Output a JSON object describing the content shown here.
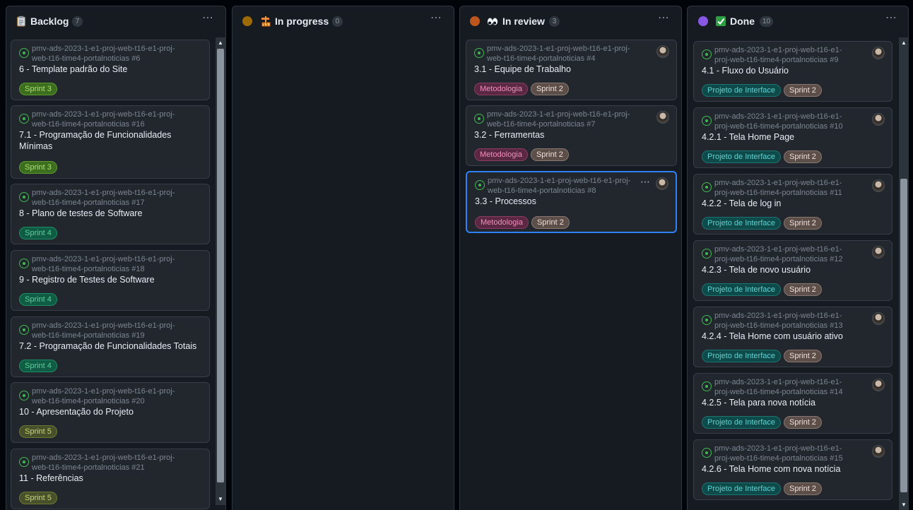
{
  "columns": [
    {
      "title": "Backlog",
      "count": "7",
      "emoji_icon": "clipboard-icon",
      "status_color": null,
      "cards": [
        {
          "repo_line1": "pmv-ads-2023-1-e1-proj-web-t16-e1-proj-",
          "repo_line2": "web-t16-time4-portalnoticias #6",
          "title": "6 - Template padrão do Site",
          "labels": [
            "Sprint 3"
          ]
        },
        {
          "repo_line1": "pmv-ads-2023-1-e1-proj-web-t16-e1-proj-",
          "repo_line2": "web-t16-time4-portalnoticias #16",
          "title": "7.1 - Programação de Funcionalidades Mínimas",
          "labels": [
            "Sprint 3"
          ]
        },
        {
          "repo_line1": "pmv-ads-2023-1-e1-proj-web-t16-e1-proj-",
          "repo_line2": "web-t16-time4-portalnoticias #17",
          "title": "8 - Plano de testes de Software",
          "labels": [
            "Sprint 4"
          ]
        },
        {
          "repo_line1": "pmv-ads-2023-1-e1-proj-web-t16-e1-proj-",
          "repo_line2": "web-t16-time4-portalnoticias #18",
          "title": "9 - Registro de Testes de Software",
          "labels": [
            "Sprint 4"
          ]
        },
        {
          "repo_line1": "pmv-ads-2023-1-e1-proj-web-t16-e1-proj-",
          "repo_line2": "web-t16-time4-portalnoticias #19",
          "title": "7.2 - Programação de Funcionalidades Totais",
          "labels": [
            "Sprint 4"
          ]
        },
        {
          "repo_line1": "pmv-ads-2023-1-e1-proj-web-t16-e1-proj-",
          "repo_line2": "web-t16-time4-portalnoticias #20",
          "title": "10 - Apresentação do Projeto",
          "labels": [
            "Sprint 5"
          ]
        },
        {
          "repo_line1": "pmv-ads-2023-1-e1-proj-web-t16-e1-proj-",
          "repo_line2": "web-t16-time4-portalnoticias #21",
          "title": "11 - Referências",
          "labels": [
            "Sprint 5"
          ]
        }
      ]
    },
    {
      "title": "In progress",
      "count": "0",
      "emoji_icon": "construction-icon",
      "status_color": "#9e6a03",
      "cards": []
    },
    {
      "title": "In review",
      "count": "3",
      "emoji_icon": "eyes-icon",
      "status_color": "#bd561d",
      "cards": [
        {
          "repo_line1": "pmv-ads-2023-1-e1-proj-web-t16-e1-proj-",
          "repo_line2": "web-t16-time4-portalnoticias #4",
          "title": "3.1 - Equipe de Trabalho",
          "labels": [
            "Metodologia",
            "Sprint 2"
          ]
        },
        {
          "repo_line1": "pmv-ads-2023-1-e1-proj-web-t16-e1-proj-",
          "repo_line2": "web-t16-time4-portalnoticias #7",
          "title": "3.2 - Ferramentas",
          "labels": [
            "Metodologia",
            "Sprint 2"
          ]
        },
        {
          "repo_line1": "pmv-ads-2023-1-e1-proj-web-t16-e1-proj-",
          "repo_line2": "web-t16-time4-portalnoticias #8",
          "title": "3.3 - Processos",
          "labels": [
            "Metodologia",
            "Sprint 2"
          ],
          "selected": true
        }
      ]
    },
    {
      "title": "Done",
      "count": "10",
      "emoji_icon": "check-mark-icon",
      "status_color": "#8957e5",
      "cards": [
        {
          "repo_line1": "pmv-ads-2023-1-e1-proj-web-t16-e1-",
          "repo_line2": "proj-web-t16-time4-portalnoticias #9",
          "title": "4.1 - Fluxo do Usuário",
          "labels": [
            "Projeto de Interface",
            "Sprint 2"
          ]
        },
        {
          "repo_line1": "pmv-ads-2023-1-e1-proj-web-t16-e1-",
          "repo_line2": "proj-web-t16-time4-portalnoticias #10",
          "title": "4.2.1 - Tela Home Page",
          "labels": [
            "Projeto de Interface",
            "Sprint 2"
          ]
        },
        {
          "repo_line1": "pmv-ads-2023-1-e1-proj-web-t16-e1-",
          "repo_line2": "proj-web-t16-time4-portalnoticias #11",
          "title": "4.2.2 - Tela de log in",
          "labels": [
            "Projeto de Interface",
            "Sprint 2"
          ]
        },
        {
          "repo_line1": "pmv-ads-2023-1-e1-proj-web-t16-e1-",
          "repo_line2": "proj-web-t16-time4-portalnoticias #12",
          "title": "4.2.3 - Tela de novo usuário",
          "labels": [
            "Projeto de Interface",
            "Sprint 2"
          ]
        },
        {
          "repo_line1": "pmv-ads-2023-1-e1-proj-web-t16-e1-",
          "repo_line2": "proj-web-t16-time4-portalnoticias #13",
          "title": "4.2.4 - Tela Home com usuário ativo",
          "labels": [
            "Projeto de Interface",
            "Sprint 2"
          ]
        },
        {
          "repo_line1": "pmv-ads-2023-1-e1-proj-web-t16-e1-",
          "repo_line2": "proj-web-t16-time4-portalnoticias #14",
          "title": "4.2.5 - Tela para nova notícia",
          "labels": [
            "Projeto de Interface",
            "Sprint 2"
          ]
        },
        {
          "repo_line1": "pmv-ads-2023-1-e1-proj-web-t16-e1-",
          "repo_line2": "proj-web-t16-time4-portalnoticias #15",
          "title": "4.2.6 - Tela Home com nova notícia",
          "labels": [
            "Projeto de Interface",
            "Sprint 2"
          ]
        }
      ]
    }
  ],
  "menu_glyph": "⋯",
  "scroll_up_glyph": "▲",
  "scroll_down_glyph": "▼"
}
